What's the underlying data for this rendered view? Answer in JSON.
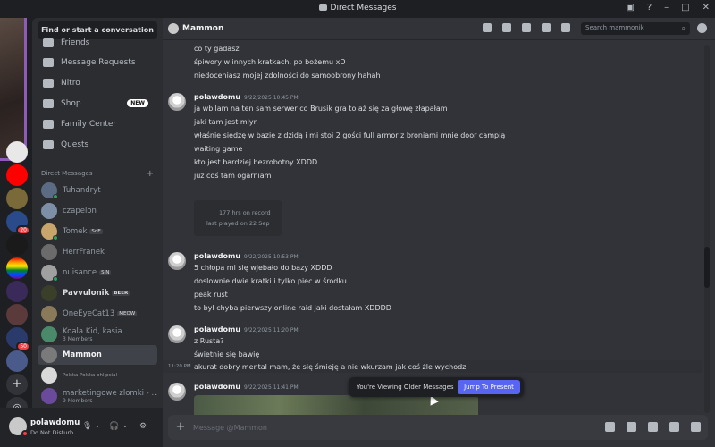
{
  "window": {
    "title": "Direct Messages"
  },
  "sidebar": {
    "search_button": "Find or start a conversation",
    "nav": [
      {
        "label": "Friends",
        "icon": "friends-icon"
      },
      {
        "label": "Message Requests",
        "icon": "mail-icon"
      },
      {
        "label": "Nitro",
        "icon": "nitro-icon"
      },
      {
        "label": "Shop",
        "icon": "shop-icon",
        "badge": "NEW"
      },
      {
        "label": "Family Center",
        "icon": "family-icon"
      },
      {
        "label": "Quests",
        "icon": "quests-icon"
      }
    ],
    "dm_header": "Direct Messages",
    "dm_add": "+",
    "dms": [
      {
        "name": "Tuhandryt",
        "sub": "",
        "tag": "",
        "color": "#5b6b83"
      },
      {
        "name": "czapelon",
        "sub": "",
        "tag": "",
        "color": "#7d8fa6"
      },
      {
        "name": "Tomek",
        "sub": "",
        "tag": "SoE",
        "color": "#c7a56b"
      },
      {
        "name": "HerrFranek",
        "sub": "",
        "tag": "",
        "color": "#6b6b6b"
      },
      {
        "name": "nuisance",
        "sub": "",
        "tag": "SIN",
        "color": "#a0a0a0"
      },
      {
        "name": "Pavvulonik",
        "sub": "",
        "tag": "BEER",
        "color": "#3a3f2a"
      },
      {
        "name": "OneEyeCat13",
        "sub": "",
        "tag": "MEOW",
        "color": "#8a7a5a"
      },
      {
        "name": "Koala Kid, kasia",
        "sub": "3 Members",
        "tag": "",
        "color": "#4a8a6a"
      },
      {
        "name": "Mammon",
        "sub": "",
        "tag": "",
        "color": "#7a7a7a"
      },
      {
        "name": "Polska Polska ohlipcial",
        "sub": "",
        "tag": "",
        "color": "#d9d9d9"
      },
      {
        "name": "marketingowe zlomki - ...",
        "sub": "9 Members",
        "tag": "",
        "color": "#6a4a9a"
      }
    ]
  },
  "user": {
    "name": "polawdomu",
    "status": "Do Not Disturb"
  },
  "rail": {
    "badges": [
      "20",
      "50"
    ]
  },
  "chat": {
    "channel_name": "Mammon",
    "search_placeholder": "Search mammonik",
    "composer_placeholder": "Message @Mammon",
    "older_banner": "You're Viewing Older Messages",
    "jump_button": "Jump To Present",
    "top_lines": [
      "co ty gadasz",
      "śpiwory w innych kratkach, po bożemu xD",
      "niedoceniasz mojej zdolności do samoobrony hahah"
    ],
    "messages": [
      {
        "author": "polawdomu",
        "timestamp": "9/22/2025 10:45 PM",
        "lines": [
          "ja wbilam na ten sam serwer co Brusik gra to aż się za głowę złapałam",
          "jaki tam jest mlyn",
          "właśnie siedzę w bazie z dzidą i mi stoi 2 gości full armor z broniami mnie door campią",
          "waiting game",
          "kto jest bardziej bezrobotny XDDD",
          "już coś tam ogarniam"
        ],
        "embed": {
          "hours": "177 hrs on record",
          "last_played": "last played on 22 Sep"
        }
      },
      {
        "author": "polawdomu",
        "timestamp": "9/22/2025 10:53 PM",
        "lines": [
          "5 chłopa mi się wjebało do bazy XDDD",
          "doslownie dwie kratki i tylko piec w środku",
          "peak rust",
          "to był chyba pierwszy online raid jaki dostałam XDDDD"
        ]
      },
      {
        "author": "polawdomu",
        "timestamp": "9/22/2025 11:20 PM",
        "lines": [
          "z Rusta?",
          "świetnie się bawię"
        ],
        "extra_time": "11:20 PM",
        "extra_line": "akurat dobry mental mam, że się śmieję a nie wkurzam jak coś źle wychodzi"
      },
      {
        "author": "polawdomu",
        "timestamp": "9/22/2025 11:41 PM",
        "lines": []
      }
    ]
  },
  "colors": {
    "accent": "#5865f2",
    "dnd": "#f23f43",
    "online": "#23a55a"
  }
}
